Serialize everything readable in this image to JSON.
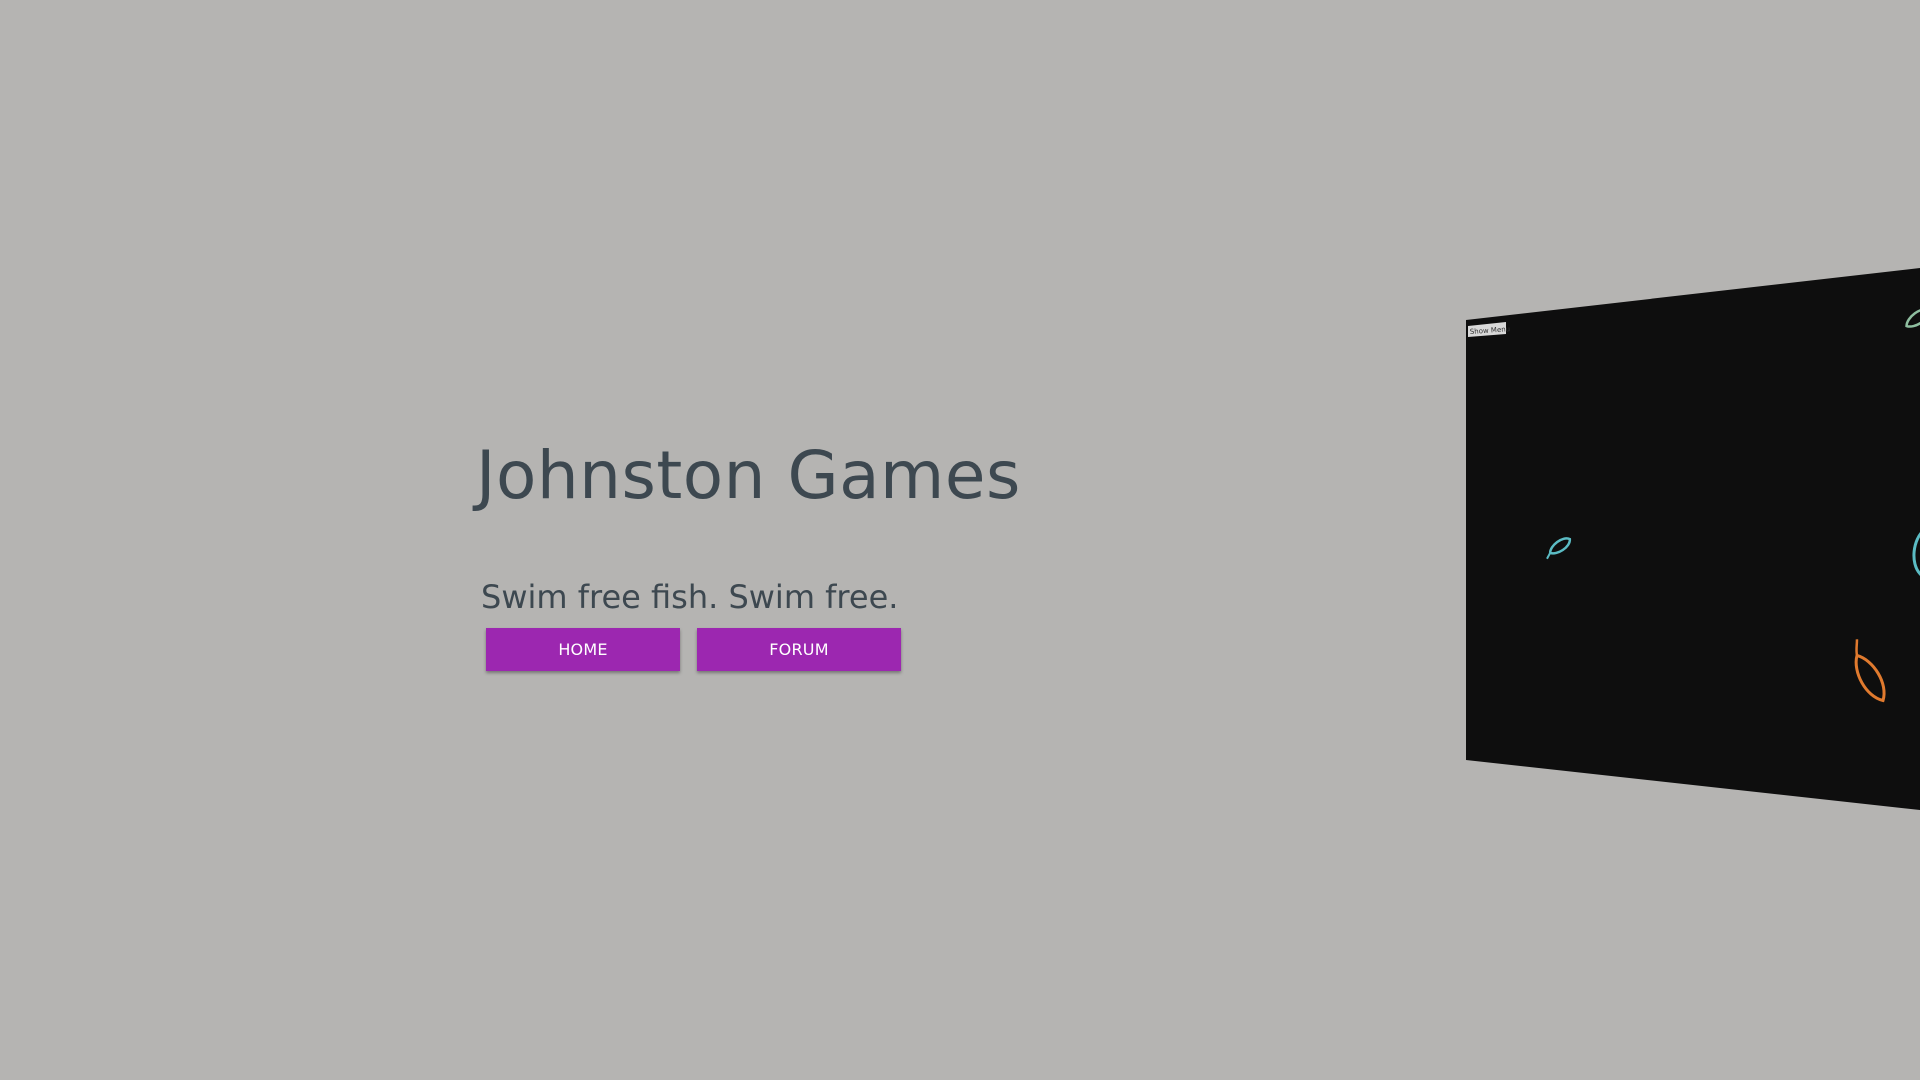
{
  "header": {
    "title": "Johnston Games",
    "tagline": "Swim free fish. Swim free."
  },
  "nav": {
    "home_label": "HOME",
    "forum_label": "FORUM"
  },
  "game_panel": {
    "menu_label": "Show Menu",
    "background_color": "#0e0e0e"
  },
  "colors": {
    "page_background": "#b5b4b2",
    "title_text": "#3d4850",
    "button_background": "#9c27b0",
    "button_text": "#ffffff",
    "fish_teal": "#5bbcc4",
    "fish_orange": "#e07a2e"
  }
}
